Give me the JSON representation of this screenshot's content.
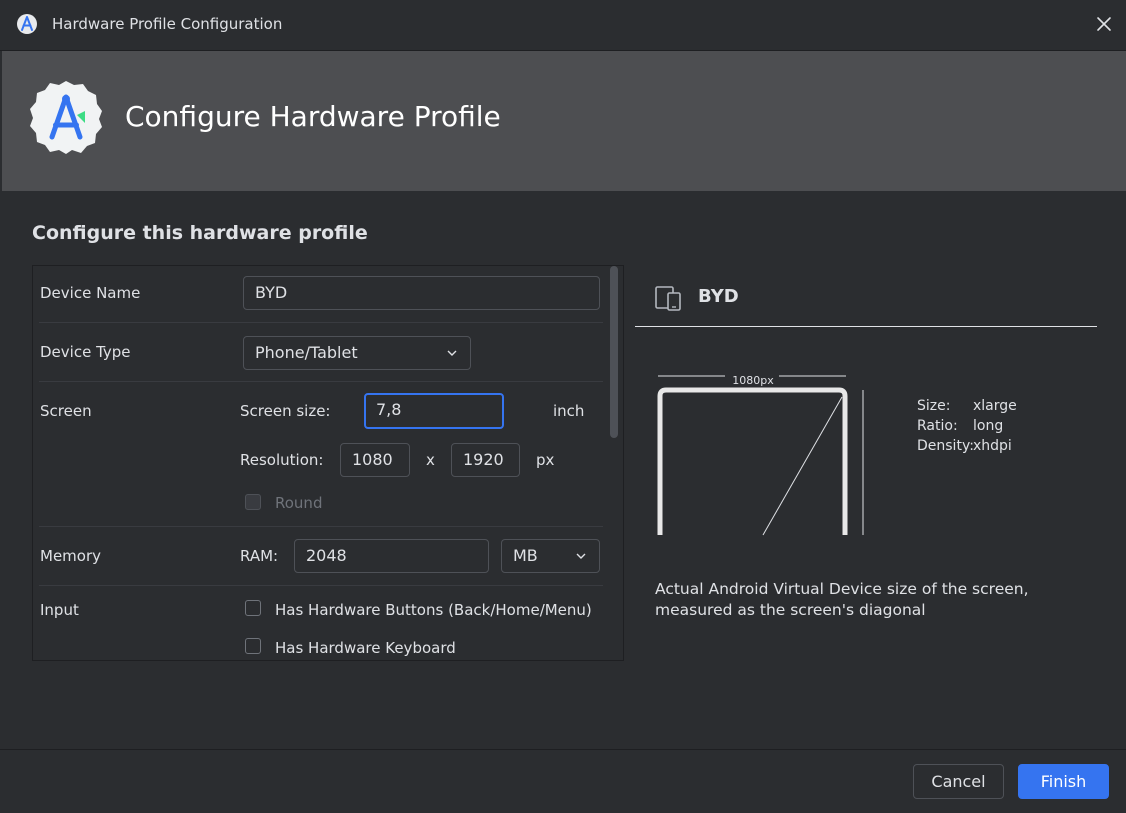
{
  "window": {
    "title": "Hardware Profile Configuration",
    "app_icon": "android-studio-icon",
    "close_icon": "close-icon"
  },
  "banner": {
    "heading": "Configure Hardware Profile",
    "logo": "android-studio-logo"
  },
  "section_title": "Configure this hardware profile",
  "form": {
    "device_name": {
      "label": "Device Name",
      "value": "BYD"
    },
    "device_type": {
      "label": "Device Type",
      "value": "Phone/Tablet"
    },
    "screen": {
      "label": "Screen",
      "size_label": "Screen size:",
      "size_value": "7,8",
      "size_unit": "inch",
      "resolution_label": "Resolution:",
      "res_width": "1080",
      "res_separator": "x",
      "res_height": "1920",
      "res_unit": "px",
      "round_label": "Round",
      "round_checked": false
    },
    "memory": {
      "label": "Memory",
      "ram_label": "RAM:",
      "ram_value": "2048",
      "ram_unit": "MB"
    },
    "input": {
      "label": "Input",
      "hw_buttons_label": "Has Hardware Buttons (Back/Home/Menu)",
      "hw_buttons_checked": false,
      "hw_keyboard_label": "Has Hardware Keyboard",
      "hw_keyboard_checked": false
    }
  },
  "preview": {
    "device_icon": "device-phone-tablet-icon",
    "name": "BYD",
    "width_label": "1080px",
    "stats": [
      {
        "key": "Size:",
        "value": "xlarge"
      },
      {
        "key": "Ratio:",
        "value": "long"
      },
      {
        "key": "Density:",
        "value": "xhdpi"
      }
    ],
    "description": "Actual Android Virtual Device size of the screen, measured as the screen's diagonal"
  },
  "footer": {
    "cancel_label": "Cancel",
    "finish_label": "Finish"
  },
  "colors": {
    "background": "#2b2d30",
    "banner": "#4d4e51",
    "accent": "#3574f0",
    "text": "#dfe1e5"
  }
}
